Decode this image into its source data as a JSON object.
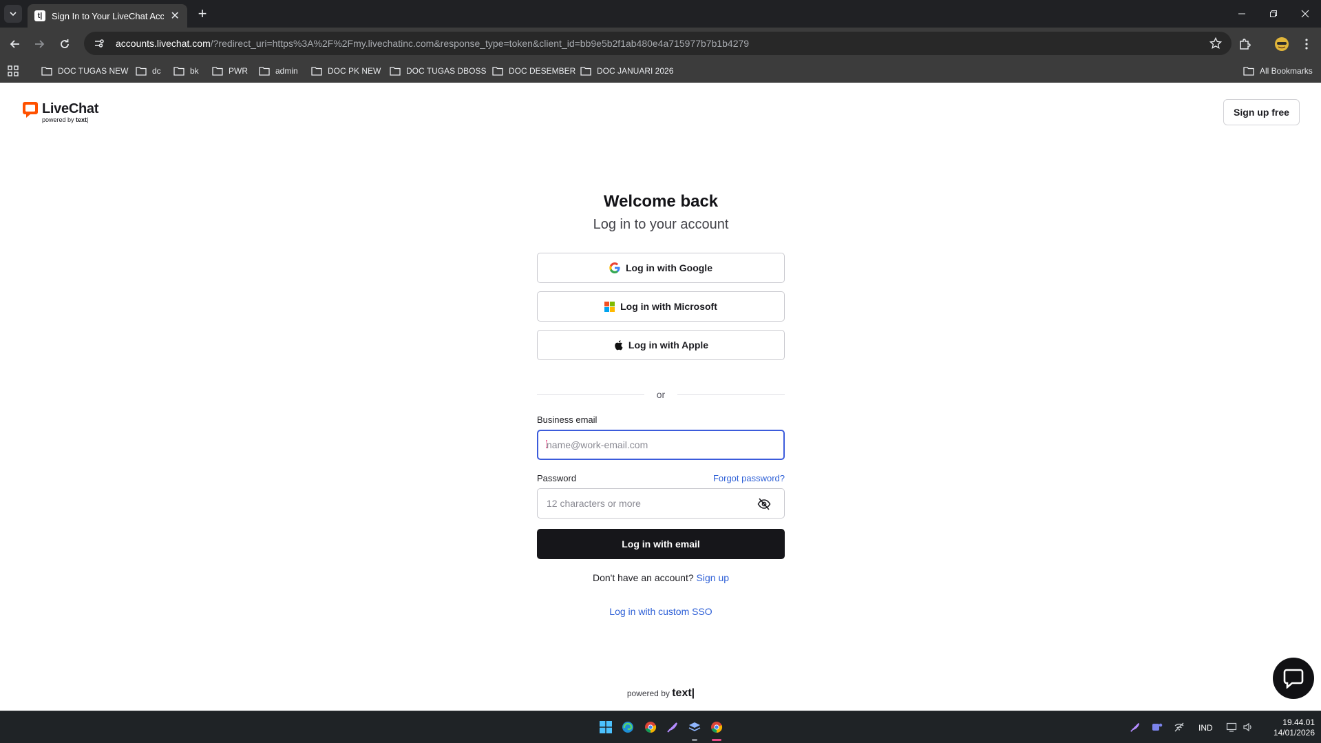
{
  "browser": {
    "tab_title": "Sign In to Your LiveChat Account",
    "url_host": "accounts.livechat.com",
    "url_rest": "/?redirect_uri=https%3A%2F%2Fmy.livechatinc.com&response_type=token&client_id=bb9e5b2f1ab480e4a715977b7b1b4279",
    "bookmarks": [
      "DOC TUGAS NEW",
      "dc",
      "bk",
      "PWR",
      "admin",
      "DOC PK NEW",
      "DOC TUGAS DBOSS",
      "DOC DESEMBER",
      "DOC JANUARI 2026"
    ],
    "all_bookmarks": "All Bookmarks"
  },
  "header": {
    "brand": "LiveChat",
    "brand_sub_prefix": "powered by",
    "brand_sub_name": "text",
    "signup_free": "Sign up free"
  },
  "login": {
    "title": "Welcome back",
    "subtitle": "Log in to your account",
    "google": "Log in with Google",
    "microsoft": "Log in with Microsoft",
    "apple": "Log in with Apple",
    "or": "or",
    "email_label": "Business email",
    "email_placeholder": "name@work-email.com",
    "password_label": "Password",
    "forgot": "Forgot password?",
    "password_placeholder": "12 characters or more",
    "submit": "Log in with email",
    "no_account": "Don't have an account?",
    "sign_up": "Sign up",
    "custom_sso": "Log in with custom SSO"
  },
  "footer": {
    "powered_prefix": "powered by",
    "powered_name": "text"
  },
  "taskbar": {
    "lang": "IND",
    "time": "19.44.01",
    "date": "14/01/2026"
  },
  "colors": {
    "brand_orange": "#ff5100",
    "link_blue": "#2d5fd6",
    "focus_blue": "#3b5bdb",
    "primary_dark": "#16161a"
  }
}
